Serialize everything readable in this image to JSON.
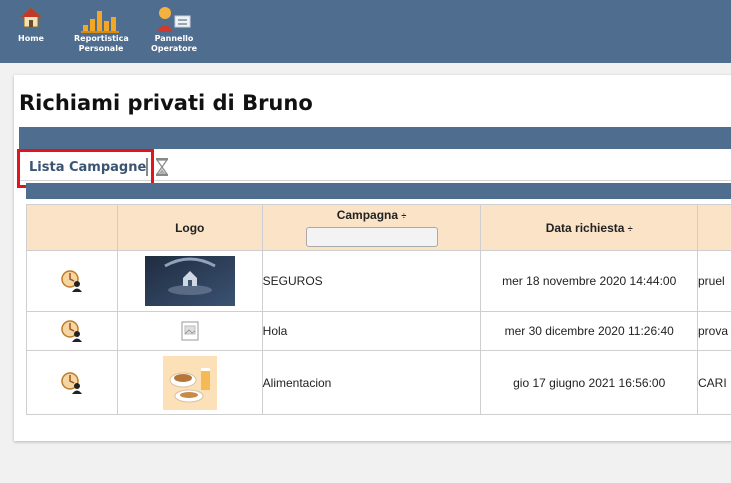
{
  "nav": [
    {
      "line1": "Home",
      "line2": ""
    },
    {
      "line1": "Reportistica",
      "line2": "Personale"
    },
    {
      "line1": "Pannello",
      "line2": "Operatore"
    }
  ],
  "page": {
    "title": "Richiami privati di Bruno"
  },
  "tabs": [
    {
      "label": "Lista Campagne"
    }
  ],
  "table": {
    "headers": {
      "icon": "",
      "logo": "Logo",
      "campagna": "Campagna",
      "data": "Data richiesta",
      "sort_glyph": "÷"
    },
    "rows": [
      {
        "campagna": "SEGUROS",
        "data": "mer 18 novembre 2020 14:44:00",
        "extra": "pruel"
      },
      {
        "campagna": "Hola",
        "data": "mer 30 dicembre 2020 11:26:40",
        "extra": "prova"
      },
      {
        "campagna": "Alimentacion",
        "data": "gio 17 giugno 2021 16:56:00",
        "extra": "CARI"
      }
    ]
  },
  "colors": {
    "header_bar": "#4f6d8f",
    "table_header": "#fbe3c8",
    "highlight": "#e3141b"
  }
}
